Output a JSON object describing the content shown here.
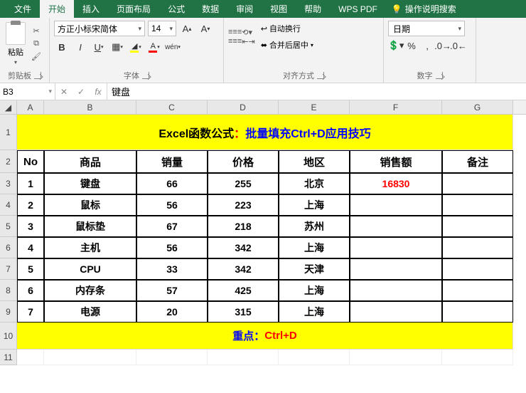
{
  "tabs": [
    "文件",
    "开始",
    "插入",
    "页面布局",
    "公式",
    "数据",
    "审阅",
    "视图",
    "帮助",
    "WPS PDF"
  ],
  "active_tab": "开始",
  "help_hint": "操作说明搜索",
  "ribbon": {
    "clipboard": {
      "label": "剪贴板",
      "paste": "粘贴"
    },
    "font": {
      "label": "字体",
      "family": "方正小标宋简体",
      "size": "14",
      "pinyin": "wén",
      "fill_color": "#ffff00",
      "text_color": "#ff0000"
    },
    "align": {
      "label": "对齐方式",
      "wrap": "自动换行",
      "merge": "合并后居中"
    },
    "number": {
      "label": "数字",
      "format": "日期"
    }
  },
  "name_box": "B3",
  "formula": "键盘",
  "columns": [
    "A",
    "B",
    "C",
    "D",
    "E",
    "F",
    "G"
  ],
  "title": {
    "part1": "Excel函数公式",
    "sep": "：",
    "part2": "批量填充Ctrl+D应用技巧"
  },
  "headers": [
    "No",
    "商品",
    "销量",
    "价格",
    "地区",
    "销售额",
    "备注"
  ],
  "rows": [
    {
      "no": "1",
      "item": "键盘",
      "qty": "66",
      "price": "255",
      "region": "北京",
      "sales": "16830"
    },
    {
      "no": "2",
      "item": "鼠标",
      "qty": "56",
      "price": "223",
      "region": "上海",
      "sales": ""
    },
    {
      "no": "3",
      "item": "鼠标垫",
      "qty": "67",
      "price": "218",
      "region": "苏州",
      "sales": ""
    },
    {
      "no": "4",
      "item": "主机",
      "qty": "56",
      "price": "342",
      "region": "上海",
      "sales": ""
    },
    {
      "no": "5",
      "item": "CPU",
      "qty": "33",
      "price": "342",
      "region": "天津",
      "sales": ""
    },
    {
      "no": "6",
      "item": "内存条",
      "qty": "57",
      "price": "425",
      "region": "上海",
      "sales": ""
    },
    {
      "no": "7",
      "item": "电源",
      "qty": "20",
      "price": "315",
      "region": "上海",
      "sales": ""
    }
  ],
  "footer": {
    "label": "重点：",
    "value": "Ctrl+D"
  },
  "chart_data": {
    "type": "table",
    "title": "Excel函数公式：批量填充Ctrl+D应用技巧",
    "columns": [
      "No",
      "商品",
      "销量",
      "价格",
      "地区",
      "销售额",
      "备注"
    ],
    "data": [
      [
        1,
        "键盘",
        66,
        255,
        "北京",
        16830,
        ""
      ],
      [
        2,
        "鼠标",
        56,
        223,
        "上海",
        null,
        ""
      ],
      [
        3,
        "鼠标垫",
        67,
        218,
        "苏州",
        null,
        ""
      ],
      [
        4,
        "主机",
        56,
        342,
        "上海",
        null,
        ""
      ],
      [
        5,
        "CPU",
        33,
        342,
        "天津",
        null,
        ""
      ],
      [
        6,
        "内存条",
        57,
        425,
        "上海",
        null,
        ""
      ],
      [
        7,
        "电源",
        20,
        315,
        "上海",
        null,
        ""
      ]
    ]
  }
}
